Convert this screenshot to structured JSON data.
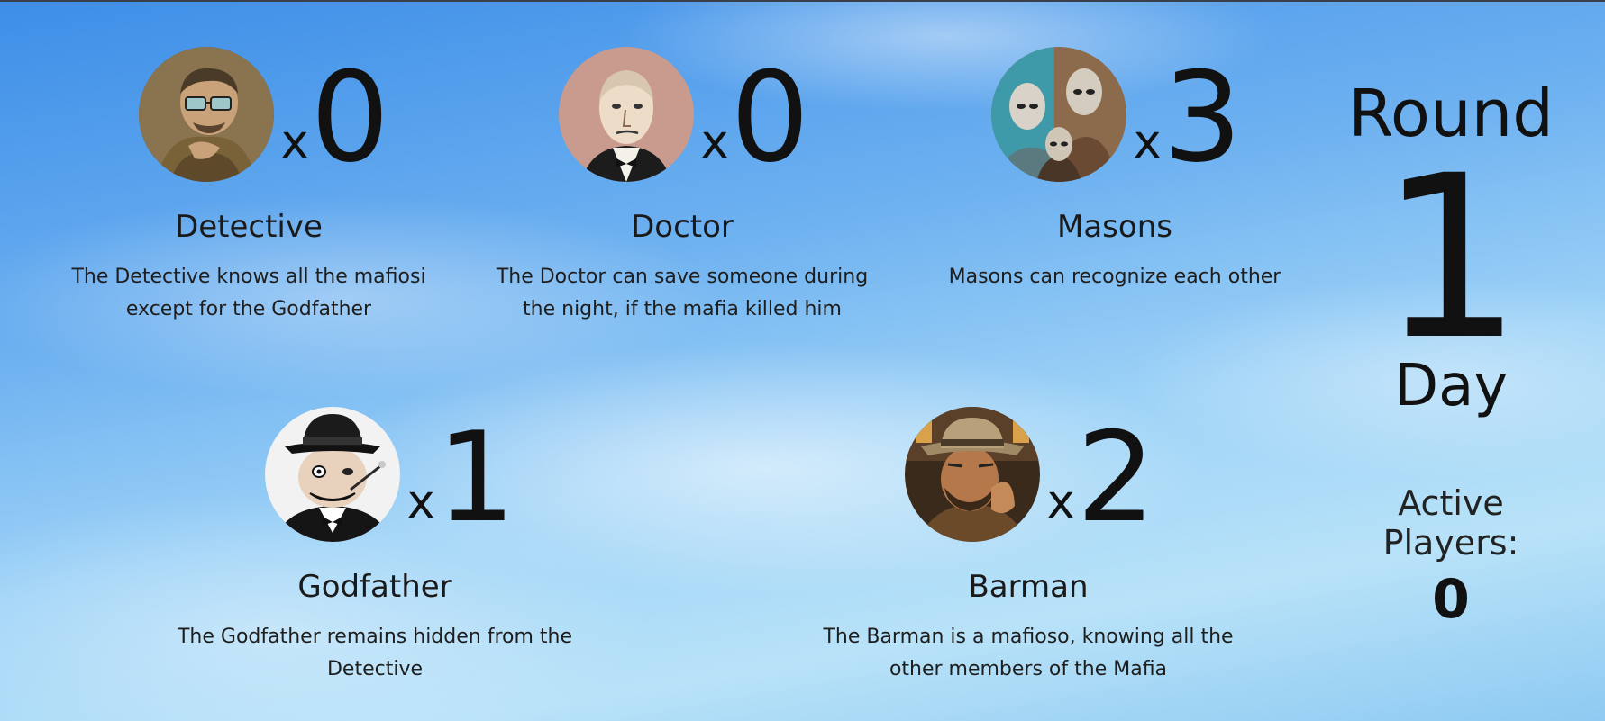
{
  "roles": [
    {
      "id": "detective",
      "name": "Detective",
      "count_prefix": "x",
      "count": "0",
      "description_lines": [
        "The Detective knows all the mafiosi",
        "except for the Godfather"
      ],
      "avatar_icon": "detective-portrait-icon"
    },
    {
      "id": "doctor",
      "name": "Doctor",
      "count_prefix": "x",
      "count": "0",
      "description_lines": [
        "The Doctor can save someone during",
        "the night, if the mafia killed him"
      ],
      "avatar_icon": "doctor-portrait-icon"
    },
    {
      "id": "masons",
      "name": "Masons",
      "count_prefix": "x",
      "count": "3",
      "description_lines": [
        "Masons can recognize each other"
      ],
      "avatar_icon": "masons-portrait-icon"
    },
    {
      "id": "godfather",
      "name": "Godfather",
      "count_prefix": "x",
      "count": "1",
      "description_lines": [
        "The Godfather remains hidden from the",
        "Detective"
      ],
      "avatar_icon": "godfather-portrait-icon"
    },
    {
      "id": "barman",
      "name": "Barman",
      "count_prefix": "x",
      "count": "2",
      "description_lines": [
        "The Barman is a mafioso, knowing all the",
        "other members of the Mafia"
      ],
      "avatar_icon": "barman-portrait-icon"
    }
  ],
  "status": {
    "round_label": "Round",
    "round_number": "1",
    "phase": "Day",
    "players_label": "Active Players:",
    "players_count": "0"
  },
  "colors": {
    "sky_top": "#3d8ee8",
    "sky_bottom": "#b8e2f8",
    "text": "#1a1a1a"
  }
}
